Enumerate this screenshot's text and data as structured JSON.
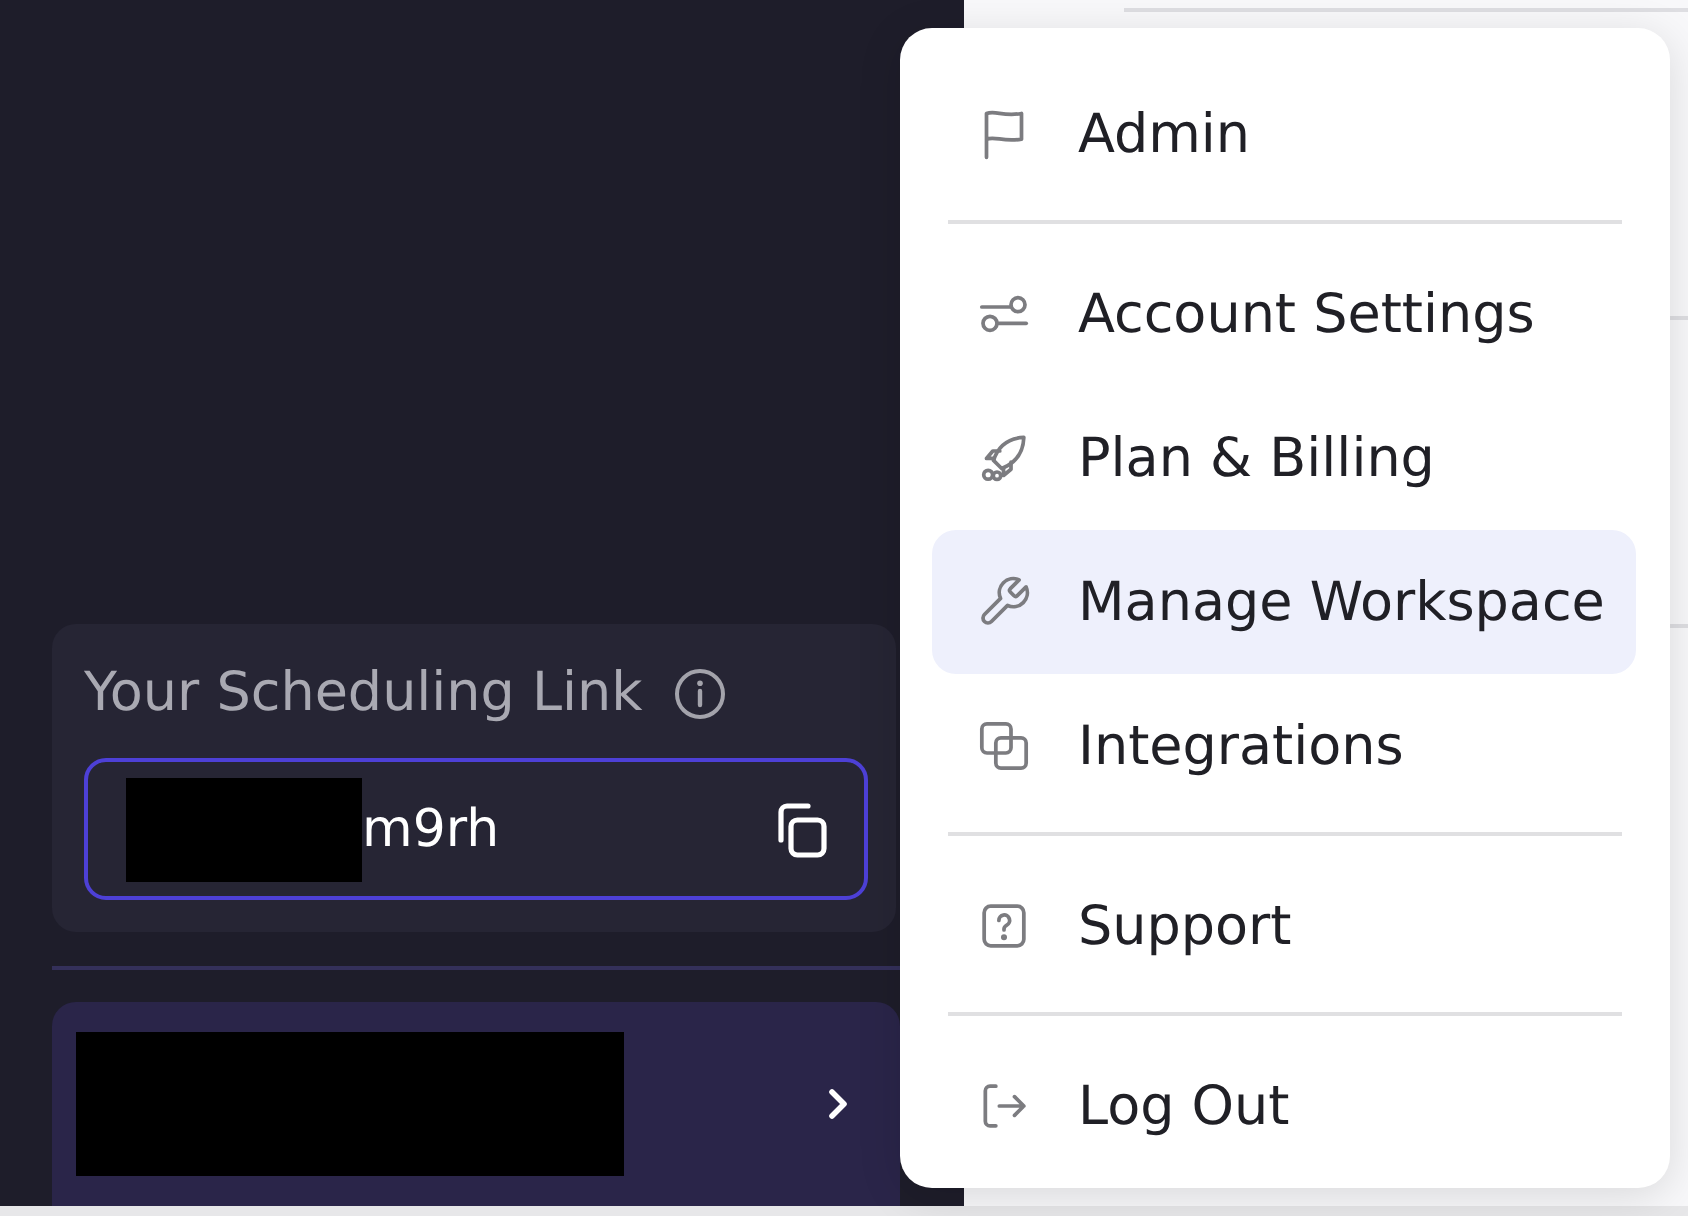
{
  "sidebar": {
    "scheduling_link": {
      "label": "Your Scheduling Link",
      "value": "m9rh"
    }
  },
  "menu": {
    "groups": [
      {
        "items": [
          {
            "label": "Admin",
            "selected": false
          }
        ]
      },
      {
        "items": [
          {
            "label": "Account Settings",
            "selected": false
          },
          {
            "label": "Plan & Billing",
            "selected": false
          },
          {
            "label": "Manage Workspace",
            "selected": true
          },
          {
            "label": "Integrations",
            "selected": false
          }
        ]
      },
      {
        "items": [
          {
            "label": "Support",
            "selected": false
          }
        ]
      },
      {
        "items": [
          {
            "label": "Log Out",
            "selected": false
          }
        ]
      }
    ]
  }
}
